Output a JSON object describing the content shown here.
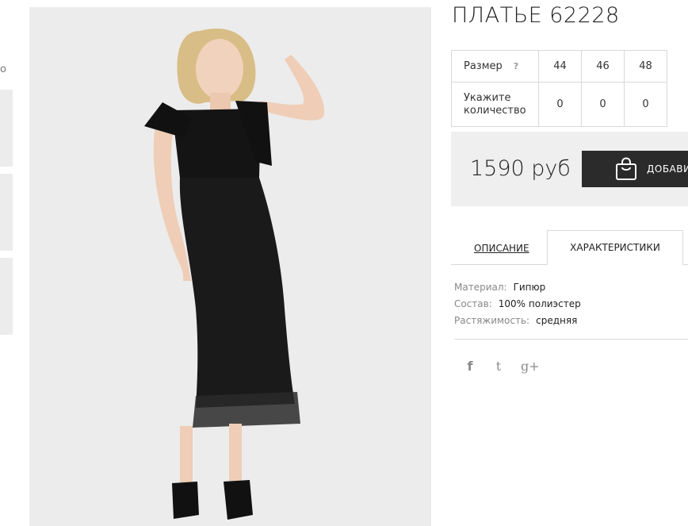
{
  "left": {
    "label_fragment": "о"
  },
  "product": {
    "title": "ПЛАТЬЕ 62228"
  },
  "size_table": {
    "size_label": "Размер",
    "help_mark": "?",
    "sizes": [
      "44",
      "46",
      "48"
    ],
    "qty_label": "Укажите количество",
    "quantities": [
      "0",
      "0",
      "0"
    ]
  },
  "purchase": {
    "price": "1590 руб",
    "add_button_label": "ДОБАВИТЬ В КОРЗИНУ"
  },
  "tabs": {
    "description": "ОПИСАНИЕ",
    "characteristics": "ХАРАКТЕРИСТИКИ",
    "active": "characteristics"
  },
  "specs": [
    {
      "key": "Материал:",
      "value": "Гипюр"
    },
    {
      "key": "Состав:",
      "value": "100% полиэстер"
    },
    {
      "key": "Растяжимость:",
      "value": "средняя"
    }
  ],
  "social": {
    "facebook_glyph": "f",
    "twitter_glyph": "t",
    "googleplus_glyph": "g+",
    "icons": [
      "facebook-icon",
      "twitter-icon",
      "google-plus-icon"
    ]
  },
  "colors": {
    "button_bg": "#2b2b2b",
    "price_box_bg": "#efefef",
    "photo_bg": "#ececec",
    "icon_grey": "#8a8a8a"
  }
}
